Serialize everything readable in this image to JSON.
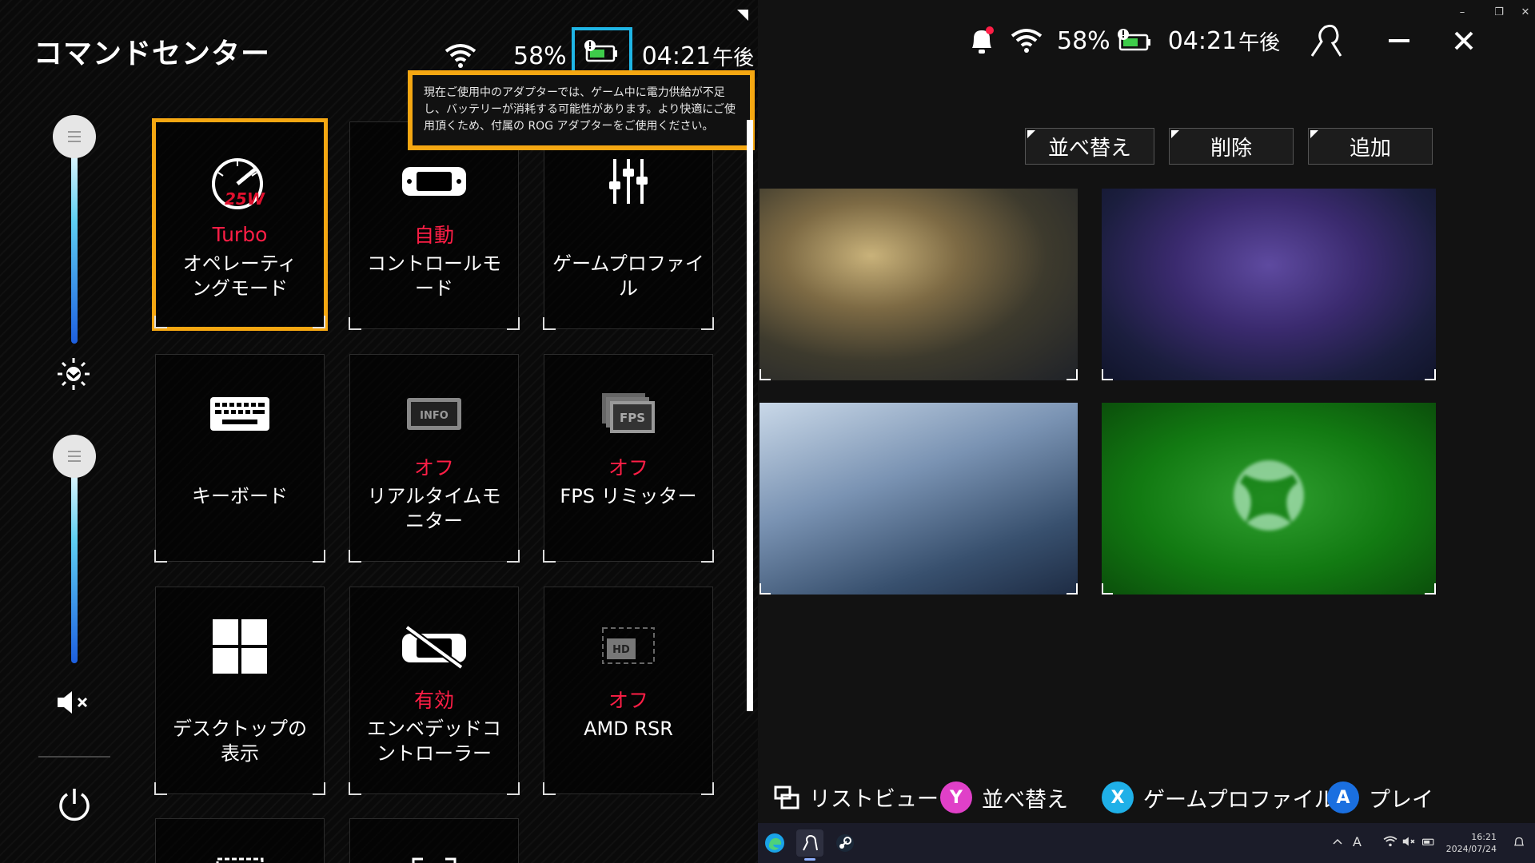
{
  "command_center": {
    "title": "コマンドセンター",
    "battery_percent": "58%",
    "time": "04:21",
    "time_suffix": "午後",
    "tooltip": "現在ご使用中のアダプターでは、ゲーム中に電力供給が不足し、バッテリーが消耗する可能性があります。より快適にご使用頂くため、付属の ROG アダプターをご使用ください。",
    "sliders": {
      "brightness_level": 1.0,
      "volume_level": 1.0
    },
    "tiles": [
      {
        "id": "operating-mode",
        "icon": "gauge-icon",
        "badge": "25W",
        "status": "Turbo",
        "label": "オペレーティングモード",
        "selected": true
      },
      {
        "id": "control-mode",
        "icon": "gamepad-icon",
        "status": "自動",
        "label": "コントロールモード"
      },
      {
        "id": "game-profile",
        "icon": "equalizer-icon",
        "status": "",
        "label": "ゲームプロファイル"
      },
      {
        "id": "keyboard",
        "icon": "keyboard-icon",
        "status": "",
        "label": "キーボード"
      },
      {
        "id": "realtime-monitor",
        "icon": "info-monitor-icon",
        "icon_text": "INFO",
        "status": "オフ",
        "label": "リアルタイムモニター"
      },
      {
        "id": "fps-limiter",
        "icon": "fps-icon",
        "icon_text": "FPS",
        "status": "オフ",
        "label": "FPS リミッター"
      },
      {
        "id": "show-desktop",
        "icon": "windows-logo-icon",
        "status": "",
        "label": "デスクトップの表示"
      },
      {
        "id": "embedded-controller",
        "icon": "controller-disabled-icon",
        "status": "有効",
        "label": "エンベデッドコントローラー"
      },
      {
        "id": "amd-rsr",
        "icon": "hd-icon",
        "icon_text": "HD",
        "status": "オフ",
        "label": "AMD RSR"
      }
    ]
  },
  "library": {
    "battery_percent": "58%",
    "time": "04:21",
    "time_suffix": "午後",
    "buttons": {
      "sort": "並べ替え",
      "delete": "削除",
      "add": "追加"
    },
    "footer": {
      "list_view": "リストビュー",
      "sort": "並べ替え",
      "sort_key": "Y",
      "game_profile": "ゲームプロファイル",
      "game_profile_key": "X",
      "play": "プレイ",
      "play_key": "A"
    },
    "colors": {
      "y_button": "#e040c8",
      "x_button": "#1fb0e8",
      "a_button": "#1a6fe0",
      "status_red": "#ff1e46",
      "highlight": "#f5a712"
    }
  },
  "taskbar": {
    "time": "16:21",
    "date": "2024/07/24",
    "ime": "A"
  }
}
